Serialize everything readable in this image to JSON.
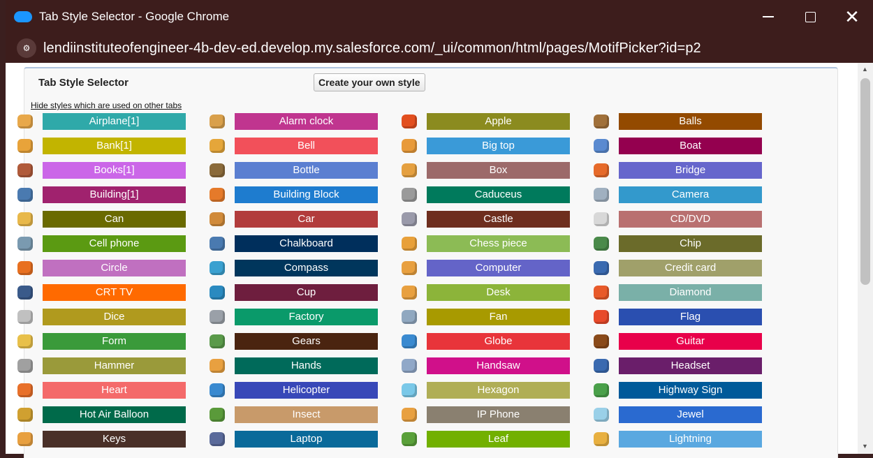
{
  "window": {
    "title": "Tab Style Selector - Google Chrome"
  },
  "address": {
    "url": "lendiinstituteofengineer-4b-dev-ed.develop.my.salesforce.com/_ui/common/html/pages/MotifPicker?id=p2"
  },
  "panel": {
    "title": "Tab Style Selector",
    "create_button": "Create your own style",
    "hide_link": "Hide styles which are used on other tabs"
  },
  "styles": [
    {
      "label": "Airplane[1]",
      "color": "#2fa9a9",
      "icon": "#e8a84a"
    },
    {
      "label": "Alarm clock",
      "color": "#c0358f",
      "icon": "#d9a04b"
    },
    {
      "label": "Apple",
      "color": "#8b8b1f",
      "icon": "#e24f1f"
    },
    {
      "label": "Balls",
      "color": "#934a00",
      "icon": "#a0703a"
    },
    {
      "label": "Bank[1]",
      "color": "#c2b400",
      "icon": "#e8a33a"
    },
    {
      "label": "Bell",
      "color": "#f2505a",
      "icon": "#e5a63a"
    },
    {
      "label": "Big top",
      "color": "#3a9ad8",
      "icon": "#e89a3a"
    },
    {
      "label": "Boat",
      "color": "#94004f",
      "icon": "#5a8ad0"
    },
    {
      "label": "Books[1]",
      "color": "#cb66e8",
      "icon": "#b05a3a"
    },
    {
      "label": "Bottle",
      "color": "#5b7fd1",
      "icon": "#8a6a3a"
    },
    {
      "label": "Box",
      "color": "#9c6a6a",
      "icon": "#e5a040"
    },
    {
      "label": "Bridge",
      "color": "#6666cc",
      "icon": "#e66a2a"
    },
    {
      "label": "Building[1]",
      "color": "#a0226e",
      "icon": "#4a7ab0"
    },
    {
      "label": "Building Block",
      "color": "#1e7ccf",
      "icon": "#e57a2a"
    },
    {
      "label": "Caduceus",
      "color": "#007a5c",
      "icon": "#9a9a9a"
    },
    {
      "label": "Camera",
      "color": "#3399cc",
      "icon": "#a0b0c0"
    },
    {
      "label": "Can",
      "color": "#6a6a00",
      "icon": "#e8b84a"
    },
    {
      "label": "Car",
      "color": "#b23c3c",
      "icon": "#d08a3a"
    },
    {
      "label": "Castle",
      "color": "#6e2e1e",
      "icon": "#9a9aaa"
    },
    {
      "label": "CD/DVD",
      "color": "#b97070",
      "icon": "#d8d8d8"
    },
    {
      "label": "Cell phone",
      "color": "#5b9a12",
      "icon": "#7a9ab0"
    },
    {
      "label": "Chalkboard",
      "color": "#002f5c",
      "icon": "#4a7ab0"
    },
    {
      "label": "Chess piece",
      "color": "#8cbb55",
      "icon": "#e8a03a"
    },
    {
      "label": "Chip",
      "color": "#6b6b2a",
      "icon": "#4a8a4a"
    },
    {
      "label": "Circle",
      "color": "#c070c0",
      "icon": "#e87020"
    },
    {
      "label": "Compass",
      "color": "#00365c",
      "icon": "#3aa0d0"
    },
    {
      "label": "Computer",
      "color": "#6464c8",
      "icon": "#e8a040"
    },
    {
      "label": "Credit card",
      "color": "#a0a06a",
      "icon": "#3a6ab0"
    },
    {
      "label": "CRT TV",
      "color": "#ff6a00",
      "icon": "#3a5a8a"
    },
    {
      "label": "Cup",
      "color": "#6e1e3e",
      "icon": "#2a8ac0"
    },
    {
      "label": "Desk",
      "color": "#8cb43a",
      "icon": "#e8a040"
    },
    {
      "label": "Diamond",
      "color": "#7ab0a8",
      "icon": "#e85a2a"
    },
    {
      "label": "Dice",
      "color": "#b09a1e",
      "icon": "#c0c0c0"
    },
    {
      "label": "Factory",
      "color": "#0a9a6a",
      "icon": "#9aa0a8"
    },
    {
      "label": "Fan",
      "color": "#a89a00",
      "icon": "#90a8c0"
    },
    {
      "label": "Flag",
      "color": "#2a4fb0",
      "icon": "#e84a2a"
    },
    {
      "label": "Form",
      "color": "#3a9a3a",
      "icon": "#e8c04a"
    },
    {
      "label": "Gears",
      "color": "#4a2410",
      "icon": "#5a9a4a"
    },
    {
      "label": "Globe",
      "color": "#e8343a",
      "icon": "#3a8ad0"
    },
    {
      "label": "Guitar",
      "color": "#e8004a",
      "icon": "#8a4a1a"
    },
    {
      "label": "Hammer",
      "color": "#9a9a3a",
      "icon": "#a0a0a0"
    },
    {
      "label": "Hands",
      "color": "#006a5a",
      "icon": "#e8a040"
    },
    {
      "label": "Handsaw",
      "color": "#d0108a",
      "icon": "#90a8c8"
    },
    {
      "label": "Headset",
      "color": "#6a1e6a",
      "icon": "#3a6ab0"
    },
    {
      "label": "Heart",
      "color": "#f46a6a",
      "icon": "#e8702a"
    },
    {
      "label": "Helicopter",
      "color": "#3848b8",
      "icon": "#3a8ad0"
    },
    {
      "label": "Hexagon",
      "color": "#b0ae56",
      "icon": "#7ac8e8"
    },
    {
      "label": "Highway Sign",
      "color": "#005a9a",
      "icon": "#4aa04a"
    },
    {
      "label": "Hot Air Balloon",
      "color": "#006a4a",
      "icon": "#d0a030"
    },
    {
      "label": "Insect",
      "color": "#c89a6a",
      "icon": "#5a9a3a"
    },
    {
      "label": "IP Phone",
      "color": "#8a8070",
      "icon": "#e8a040"
    },
    {
      "label": "Jewel",
      "color": "#2a6ad0",
      "icon": "#9ad0e8"
    },
    {
      "label": "Keys",
      "color": "#4a3028",
      "icon": "#e8a040"
    },
    {
      "label": "Laptop",
      "color": "#0a6a9a",
      "icon": "#5a6a9a"
    },
    {
      "label": "Leaf",
      "color": "#72b000",
      "icon": "#5aa03a"
    },
    {
      "label": "Lightning",
      "color": "#5aa8e0",
      "icon": "#e8b040"
    }
  ]
}
